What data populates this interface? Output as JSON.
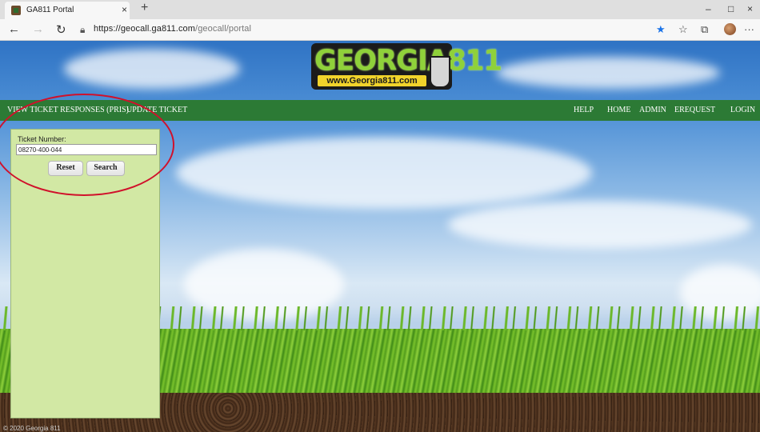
{
  "browser": {
    "tab_title": "GA811 Portal",
    "tab_close": "×",
    "new_tab": "+",
    "url_base": "https://geocall.ga811.com",
    "url_path": "/geocall/portal",
    "nav": {
      "back": "←",
      "forward": "→",
      "refresh": "↻",
      "lock": "🔒"
    },
    "window": {
      "minimize": "–",
      "maximize": "□",
      "close": "×"
    },
    "toolbar": {
      "favorite": "★",
      "favorites": "☆",
      "collections": "⧉",
      "more": "···"
    }
  },
  "logo": {
    "text": "GEORGIA811",
    "url": "www.Georgia811.com"
  },
  "navbar": {
    "left": [
      "VIEW TICKET RESPONSES (PRIS)",
      "UPDATE TICKET"
    ],
    "right": [
      "HELP",
      "HOME",
      "ADMIN",
      "EREQUEST",
      "LOGIN"
    ]
  },
  "panel": {
    "ticket_label": "Ticket Number:",
    "ticket_value": "08270-400-044",
    "reset_label": "Reset",
    "search_label": "Search"
  },
  "footer": {
    "copyright": "© 2020 Georgia 811"
  },
  "colors": {
    "navbar": "#2c7a35",
    "panel": "#d2e8a4",
    "annotation": "#d0112b"
  }
}
